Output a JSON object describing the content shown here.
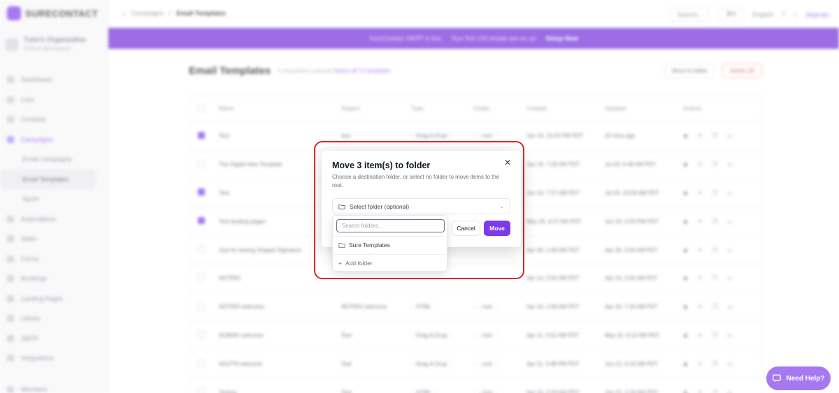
{
  "app": {
    "brand": "SURECONTACT",
    "org_name": "Tutor's Organization",
    "org_sub": "Default Workspace"
  },
  "sidebar": {
    "items": [
      {
        "label": "Dashboard"
      },
      {
        "label": "Lists"
      },
      {
        "label": "Contacts"
      },
      {
        "label": "Campaigns"
      },
      {
        "label": "Email Campaigns"
      },
      {
        "label": "Email Templates"
      },
      {
        "label": "Sprint"
      },
      {
        "label": "Automations"
      },
      {
        "label": "Sales"
      },
      {
        "label": "Forms"
      },
      {
        "label": "Bookings"
      },
      {
        "label": "Landing Pages"
      },
      {
        "label": "Library"
      },
      {
        "label": "SMTP"
      },
      {
        "label": "Integrations"
      },
      {
        "label": "Members"
      }
    ]
  },
  "topbar": {
    "crumb_parent": "Campaigns",
    "crumb_sep": "/",
    "crumb_current": "Email Templates",
    "search": "Search...",
    "shortcut": "⌘K",
    "language": "English",
    "user": "Jaypratu"
  },
  "banner": {
    "text": "SureContact SMTP is live.",
    "sub": "Your first 100 emails are on us.",
    "cta": "Setup Now"
  },
  "page": {
    "title": "Email Templates",
    "selected_note": "3 template(s) selected",
    "select_all": "Select all 12 templates",
    "move_btn": "Move to folder",
    "delete_btn": "Delete (3)"
  },
  "table": {
    "headers": [
      "Name",
      "Subject",
      "Type",
      "Folder",
      "Created",
      "Updated",
      "Actions"
    ],
    "rows": [
      {
        "checked": true,
        "name": "Test",
        "subject": "test",
        "type": "Drag & Drop",
        "folder": "- root",
        "created": "Jun 16, 10:24 PM PDT",
        "updated": "20 mins ago"
      },
      {
        "checked": false,
        "name": "The Digital Idea Template",
        "subject": "",
        "type": "",
        "folder": "",
        "created": "Jun 16, 7:28 AM PDT",
        "updated": "Jul 03, 6:48 AM PDT"
      },
      {
        "checked": true,
        "name": "Test",
        "subject": "",
        "type": "",
        "folder": "",
        "created": "Jun 16, 7:27 AM PDT",
        "updated": "Jul 03, 10:06 AM PDT"
      },
      {
        "checked": true,
        "name": "Test landing pages",
        "subject": "",
        "type": "",
        "folder": "",
        "created": "May 29, 4:27 AM PDT",
        "updated": "Jun 10, 4:25 PM PDT"
      },
      {
        "checked": false,
        "name": "Just for testing Snippet Signature",
        "subject": "",
        "type": "",
        "folder": "",
        "created": "Apr 30, 2:49 AM PDT",
        "updated": "Apr 30, 3:03 AM PDT"
      },
      {
        "checked": false,
        "name": "NOTRIO",
        "subject": "",
        "type": "",
        "folder": "",
        "created": "Apr 14, 2:50 AM PDT",
        "updated": "Apr 14, 2:50 AM PDT"
      },
      {
        "checked": false,
        "name": "NOTRIO welcome",
        "subject": "NOTRIO welcome",
        "type": "HTML",
        "folder": "- root",
        "created": "Apr 14, 1:58 AM PDT",
        "updated": "Apr 24, 7:16 AM PDT"
      },
      {
        "checked": false,
        "name": "NOMAD welcome",
        "subject": "Test",
        "type": "Drag & Drop",
        "folder": "- root",
        "created": "Apr 11, 3:52 AM PDT",
        "updated": "May 22, 8:12 AM PDT"
      },
      {
        "checked": false,
        "name": "NAOTN welcome",
        "subject": "Test",
        "type": "Drag & Drop",
        "folder": "- root",
        "created": "Apr 11, 3:48 PM PDT",
        "updated": "Jun 21, 6:16 AM PDT"
      },
      {
        "checked": false,
        "name": "Testing",
        "subject": "Test",
        "type": "HTML",
        "folder": "- root",
        "created": "Apr 10, 2:24 AM PDT",
        "updated": "Jun 21, 2:16 AM PDT"
      }
    ]
  },
  "help": {
    "label": "Need Help?"
  },
  "modal": {
    "title": "Move 3 item(s) to folder",
    "description": "Choose a destination folder, or select no folder to move items to the root.",
    "select_placeholder": "Select folder (optional)",
    "cancel": "Cancel",
    "move": "Move"
  },
  "dropdown": {
    "search_placeholder": "Search folders...",
    "options": [
      "Sure Templates"
    ],
    "add_label": "Add folder"
  },
  "colors": {
    "accent": "#7c3aed",
    "highlight": "#dc2626"
  }
}
